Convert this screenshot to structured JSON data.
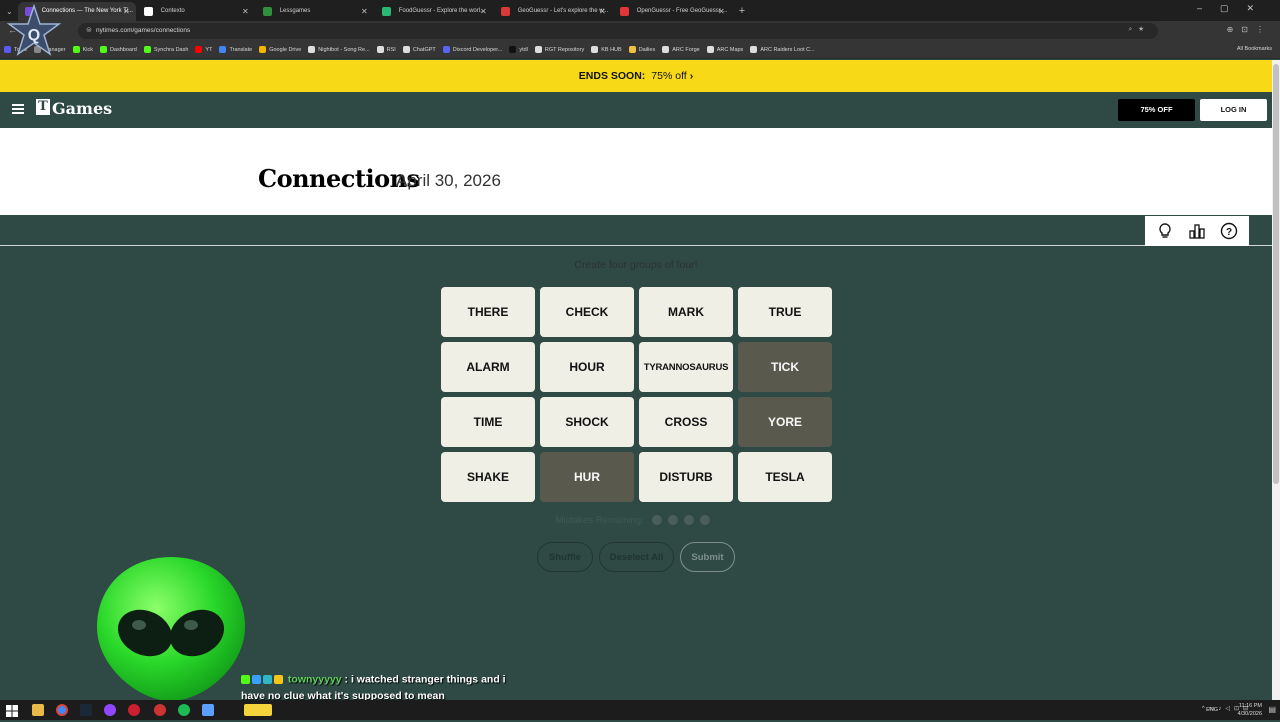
{
  "browser": {
    "tabs": [
      {
        "title": "Connections — The New York Ti...",
        "color": "#7a4ad8",
        "active": true
      },
      {
        "title": "Contexto",
        "color": "#ffffff",
        "active": false
      },
      {
        "title": "Lessgames",
        "color": "#2f8f3f",
        "active": false
      },
      {
        "title": "FoodGuessr - Explore the worl...",
        "color": "#2bb673",
        "active": false
      },
      {
        "title": "GeoGuessr - Let's explore the w...",
        "color": "#d83a3a",
        "active": false
      },
      {
        "title": "OpenGuessr - Free GeoGuessr ...",
        "color": "#e33535",
        "active": false
      }
    ],
    "url": "nytimes.com/games/connections",
    "bookmarks": [
      {
        "label": "Tools",
        "color": "#5a5aff"
      },
      {
        "label": "Manager",
        "color": "#888888"
      },
      {
        "label": "Kick",
        "color": "#53fc18"
      },
      {
        "label": "Dashboard",
        "color": "#53fc18"
      },
      {
        "label": "Synchra Dash",
        "color": "#53fc18"
      },
      {
        "label": "YT",
        "color": "#ff0000"
      },
      {
        "label": "Translate",
        "color": "#4285f4"
      },
      {
        "label": "Google Drive",
        "color": "#f4b400"
      },
      {
        "label": "Nightbot - Song Re...",
        "color": "#dddddd"
      },
      {
        "label": "RSI",
        "color": "#dddddd"
      },
      {
        "label": "ChatGPT",
        "color": "#dddddd"
      },
      {
        "label": "Discord Developer...",
        "color": "#5865f2"
      },
      {
        "label": "ytdl",
        "color": "#111111"
      },
      {
        "label": "RGT Repository",
        "color": "#dddddd"
      },
      {
        "label": "KB HUB",
        "color": "#dddddd"
      },
      {
        "label": "Dailies",
        "color": "#f0c040"
      },
      {
        "label": "ARC Forge",
        "color": "#dddddd"
      },
      {
        "label": "ARC Maps",
        "color": "#dddddd"
      },
      {
        "label": "ARC Raiders Loot C...",
        "color": "#dddddd"
      }
    ],
    "all_bookmarks": "All Bookmarks"
  },
  "promo": {
    "label": "ENDS SOON:",
    "price": "75% off",
    "chevron": "›"
  },
  "header": {
    "logo_t": "T",
    "logo": "Games",
    "subscribe": "75% OFF",
    "login": "LOG IN"
  },
  "title": {
    "name": "Connections",
    "date": "April 30, 2026"
  },
  "toolbar": {
    "icons": [
      "lightbulb-icon",
      "stats-icon",
      "help-icon"
    ]
  },
  "game": {
    "instructions": "Create four groups of four!",
    "tiles": [
      {
        "word": "THERE",
        "selected": false
      },
      {
        "word": "CHECK",
        "selected": false
      },
      {
        "word": "MARK",
        "selected": false
      },
      {
        "word": "TRUE",
        "selected": false
      },
      {
        "word": "ALARM",
        "selected": false
      },
      {
        "word": "HOUR",
        "selected": false
      },
      {
        "word": "TYRANNOSAURUS",
        "selected": false
      },
      {
        "word": "TICK",
        "selected": true
      },
      {
        "word": "TIME",
        "selected": false
      },
      {
        "word": "SHOCK",
        "selected": false
      },
      {
        "word": "CROSS",
        "selected": false
      },
      {
        "word": "YORE",
        "selected": true
      },
      {
        "word": "SHAKE",
        "selected": false
      },
      {
        "word": "HUR",
        "selected": true
      },
      {
        "word": "DISTURB",
        "selected": false
      },
      {
        "word": "TESLA",
        "selected": false
      }
    ],
    "mistakes_label": "Mistakes Remaining:",
    "mistakes_remaining": 4,
    "buttons": {
      "shuffle": "Shuffle",
      "deselect": "Deselect All",
      "submit": "Submit"
    }
  },
  "chat": {
    "user": "townyyyyy",
    "message": ": i watched stranger things and i have no clue what it's supposed to mean",
    "badge_colors": [
      "#53fc18",
      "#3aa0ff",
      "#2fb7c8",
      "#f5c518"
    ]
  },
  "taskbar": {
    "lang": "ENG",
    "time": "11:16 PM",
    "date": "4/30/2026"
  }
}
